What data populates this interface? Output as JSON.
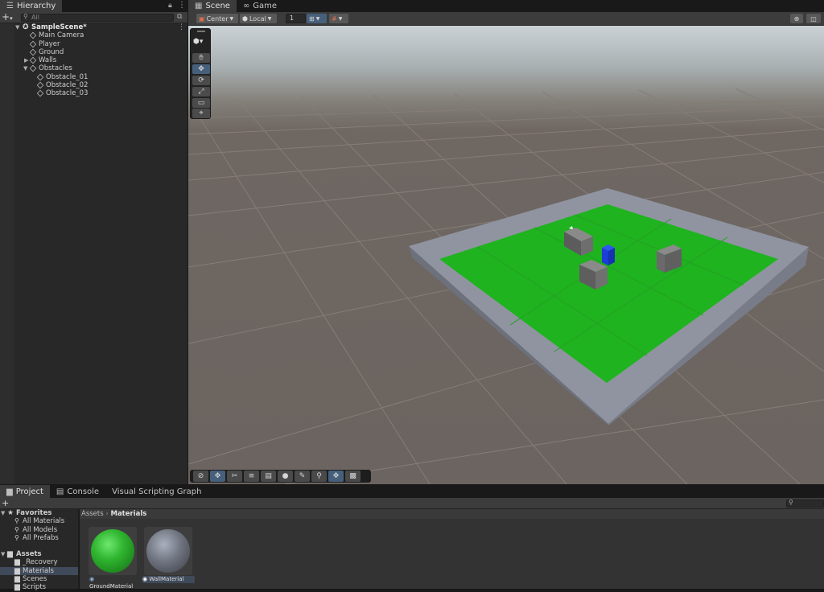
{
  "hierarchy": {
    "tab_label": "Hierarchy",
    "search_placeholder": "All",
    "scene_name": "SampleScene*",
    "items": [
      {
        "label": "Main Camera"
      },
      {
        "label": "Player"
      },
      {
        "label": "Ground"
      },
      {
        "label": "Walls"
      },
      {
        "label": "Obstacles"
      },
      {
        "label": "Obstacle_01"
      },
      {
        "label": "Obstacle_02"
      },
      {
        "label": "Obstacle_03"
      }
    ]
  },
  "scene_view": {
    "tabs": [
      {
        "label": "Scene"
      },
      {
        "label": "Game"
      }
    ],
    "toolbar": {
      "pivot_label": "Center",
      "space_label": "Local",
      "snap_value": "1"
    },
    "colors": {
      "ground": "#1fb31f",
      "walls": "#7f8592",
      "player": "#1a3ed6",
      "obstacle": "#5b5b5b"
    }
  },
  "bottom_panel": {
    "tabs": [
      {
        "label": "Project"
      },
      {
        "label": "Console"
      },
      {
        "label": "Visual Scripting Graph"
      }
    ],
    "favorites_label": "Favorites",
    "favorites": [
      {
        "label": "All Materials"
      },
      {
        "label": "All Models"
      },
      {
        "label": "All Prefabs"
      }
    ],
    "assets_label": "Assets",
    "folders": [
      {
        "label": "_Recovery"
      },
      {
        "label": "Materials"
      },
      {
        "label": "Scenes"
      },
      {
        "label": "Scripts"
      }
    ],
    "breadcrumb": {
      "root": "Assets",
      "current": "Materials"
    },
    "assets": [
      {
        "label": "GroundMaterial",
        "color": "#2fb52f"
      },
      {
        "label": "WallMaterial",
        "color": "#6f7480"
      }
    ]
  }
}
